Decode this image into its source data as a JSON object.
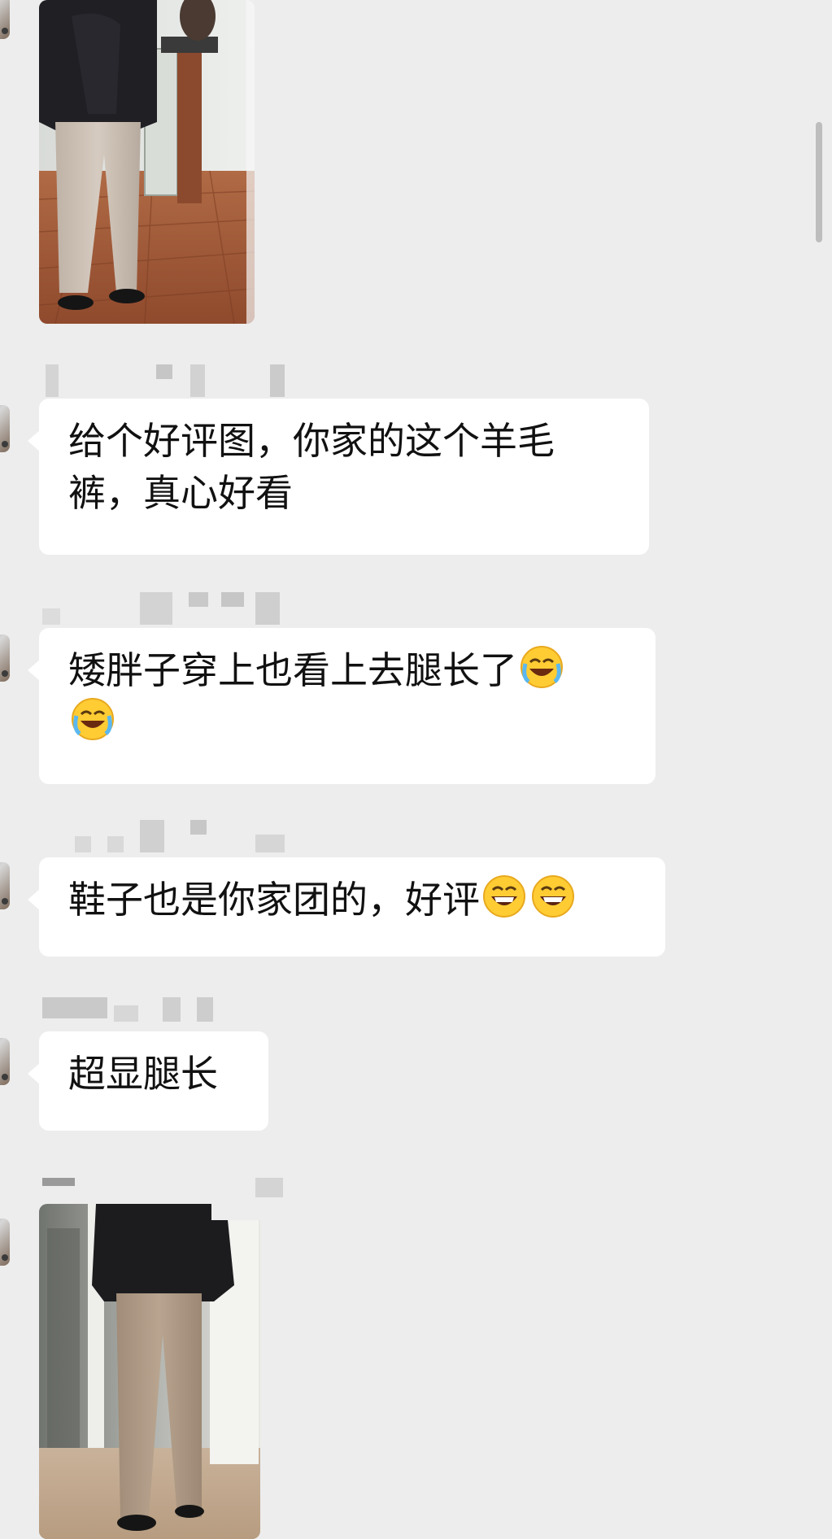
{
  "messages": [
    {
      "type": "image",
      "description": "photo-top",
      "sender_visible": false
    },
    {
      "type": "text",
      "text": "给个好评图，你家的这个羊毛裤，真心好看"
    },
    {
      "type": "text",
      "text": "矮胖子穿上也看上去腿长了",
      "trailing_emojis": [
        "crying-laughing",
        "crying-laughing"
      ]
    },
    {
      "type": "text",
      "text": "鞋子也是你家团的，好评",
      "trailing_emojis": [
        "grinning",
        "grinning"
      ]
    },
    {
      "type": "text",
      "text": "超显腿长"
    },
    {
      "type": "image",
      "description": "photo-bottom"
    }
  ],
  "colors": {
    "background": "#ededed",
    "bubble": "#ffffff",
    "text": "#111111",
    "scrollbar": "#bdbdbd"
  },
  "icons": [
    "avatar",
    "crying-laughing-emoji",
    "grinning-emoji",
    "scrollbar-thumb"
  ]
}
